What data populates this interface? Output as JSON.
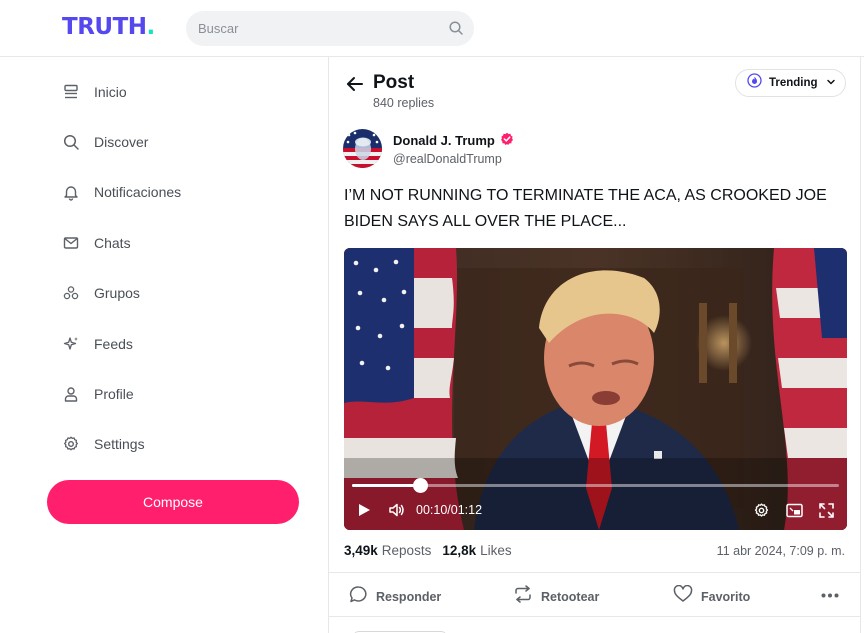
{
  "brand": {
    "logo_text": "TRUTH",
    "logo_dot": ".",
    "primary_color": "#5448ee",
    "accent_color": "#17e2c7",
    "compose_color": "#ff1f6d"
  },
  "search": {
    "placeholder": "Buscar",
    "icon": "search-icon"
  },
  "sidebar": {
    "items": [
      {
        "label": "Inicio",
        "icon": "home-icon"
      },
      {
        "label": "Discover",
        "icon": "search-icon"
      },
      {
        "label": "Notificaciones",
        "icon": "bell-icon"
      },
      {
        "label": "Chats",
        "icon": "mail-icon"
      },
      {
        "label": "Grupos",
        "icon": "groups-icon"
      },
      {
        "label": "Feeds",
        "icon": "sparkle-icon"
      },
      {
        "label": "Profile",
        "icon": "user-icon"
      },
      {
        "label": "Settings",
        "icon": "gear-icon"
      }
    ],
    "compose_label": "Compose"
  },
  "header": {
    "title": "Post",
    "replies": "840 replies",
    "sort_label": "Trending"
  },
  "post": {
    "author_name": "Donald J. Trump",
    "author_handle": "@realDonaldTrump",
    "verified": true,
    "text": "I’M NOT RUNNING TO TERMINATE THE ACA, AS CROOKED JOE BIDEN SAYS ALL OVER THE PLACE...",
    "video": {
      "current_time": "00:10",
      "separator": "/",
      "duration": "01:12",
      "progress_fraction": 0.139
    },
    "reposts_count": "3,49k",
    "reposts_label": "Reposts",
    "likes_count": "12,8k",
    "likes_label": "Likes",
    "timestamp": "11 abr 2024, 7:09 p. m."
  },
  "actions": {
    "reply_label": "Responder",
    "retruth_label": "Retootear",
    "favorite_label": "Favorito"
  }
}
